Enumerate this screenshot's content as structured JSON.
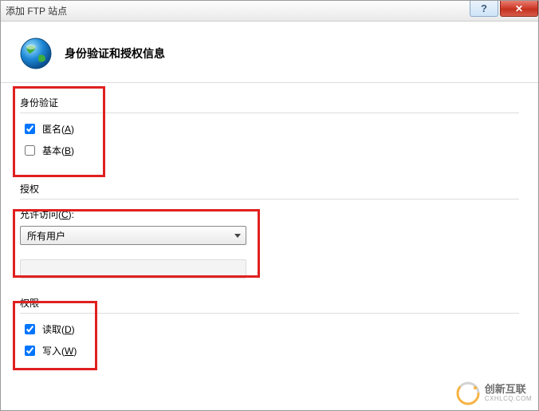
{
  "window": {
    "title": "添加 FTP 站点",
    "help": "?",
    "close": "✕"
  },
  "header": {
    "title": "身份验证和授权信息"
  },
  "auth": {
    "group_label": "身份验证",
    "anonymous_label_pre": "匿名(",
    "anonymous_key": "A",
    "anonymous_label_post": ")",
    "anonymous_checked": true,
    "basic_label_pre": "基本(",
    "basic_key": "B",
    "basic_label_post": ")",
    "basic_checked": false
  },
  "authorization": {
    "group_label": "授权",
    "access_label_pre": "允许访问(",
    "access_key": "C",
    "access_label_post": "):",
    "dropdown_value": "所有用户"
  },
  "permissions": {
    "group_label": "权限",
    "read_label_pre": "读取(",
    "read_key": "D",
    "read_label_post": ")",
    "read_checked": true,
    "write_label_pre": "写入(",
    "write_key": "W",
    "write_label_post": ")",
    "write_checked": true
  },
  "watermark": {
    "cn": "创新互联",
    "en": "CXHLCQ.COM"
  }
}
